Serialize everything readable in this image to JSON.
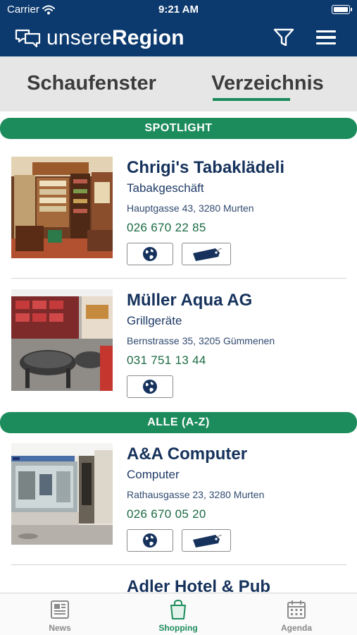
{
  "status_bar": {
    "carrier": "Carrier",
    "time": "9:21 AM"
  },
  "app": {
    "logo_light": "unsere",
    "logo_bold": "Region"
  },
  "segment": {
    "tabs": [
      {
        "label": "Schaufenster"
      },
      {
        "label": "Verzeichnis"
      }
    ],
    "selected": "Verzeichnis"
  },
  "sections": {
    "spotlight": "SPOTLIGHT",
    "all": "ALLE (A-Z)"
  },
  "listings": [
    {
      "name": "Chrigi's Tabaklädeli",
      "category": "Tabakgeschäft",
      "address": "Hauptgasse 43, 3280 Murten",
      "phone": "026 670 22 85"
    },
    {
      "name": "Müller Aqua AG",
      "category": "Grillgeräte",
      "address": "Bernstrasse  35, 3205 Gümmenen",
      "phone": "031 751 13 44"
    },
    {
      "name": "A&A Computer",
      "category": "Computer",
      "address": "Rathausgasse 23, 3280 Murten",
      "phone": "026 670 05 20"
    },
    {
      "name": "Adler Hotel & Pub"
    }
  ],
  "tabbar": {
    "tabs": [
      {
        "label": "News"
      },
      {
        "label": "Shopping"
      },
      {
        "label": "Agenda"
      }
    ],
    "active": "Shopping"
  },
  "colors": {
    "header": "#0d3a6e",
    "accent": "#1d8c5c",
    "segment_bg": "#e6e6e6",
    "name_text": "#16325c",
    "phone_text": "#1a6a42"
  },
  "icons": [
    "wifi-icon",
    "battery-icon",
    "speech-bubbles-logo-icon",
    "filter-icon",
    "hamburger-menu-icon",
    "globe-icon",
    "price-tag-icon",
    "newspaper-icon",
    "shopping-bag-icon",
    "calendar-icon"
  ]
}
